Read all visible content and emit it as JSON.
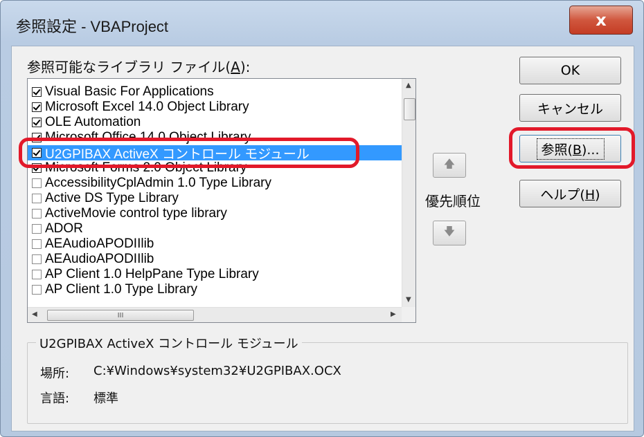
{
  "window": {
    "title": "参照設定 - VBAProject",
    "close_label": "x"
  },
  "library_label": {
    "text": "参照可能なライブラリ ファイル(",
    "mnemonic": "A",
    "suffix": "):"
  },
  "libraries": [
    {
      "name": "Visual Basic For Applications",
      "checked": true
    },
    {
      "name": "Microsoft Excel 14.0 Object Library",
      "checked": true
    },
    {
      "name": "OLE Automation",
      "checked": true
    },
    {
      "name": "Microsoft Office 14.0 Object Library",
      "checked": true
    },
    {
      "name": "U2GPIBAX ActiveX コントロール モジュール",
      "checked": true,
      "selected": true
    },
    {
      "name": "Microsoft Forms 2.0 Object Library",
      "checked": true
    },
    {
      "name": "AccessibilityCplAdmin 1.0 Type Library",
      "checked": false
    },
    {
      "name": "Active DS Type Library",
      "checked": false
    },
    {
      "name": "ActiveMovie control type library",
      "checked": false
    },
    {
      "name": "ADOR",
      "checked": false
    },
    {
      "name": "AEAudioAPODIIlib",
      "checked": false
    },
    {
      "name": "AEAudioAPODIIlib",
      "checked": false
    },
    {
      "name": "AP Client 1.0 HelpPane Type Library",
      "checked": false
    },
    {
      "name": "AP Client 1.0 Type Library",
      "checked": false
    }
  ],
  "hscroll_thumb": "III",
  "buttons": {
    "ok": "OK",
    "cancel": "キャンセル",
    "browse": {
      "text": "参照(",
      "mnemonic": "B",
      "suffix": ")..."
    },
    "help": {
      "text": "ヘルプ(",
      "mnemonic": "H",
      "suffix": ")"
    }
  },
  "priority": {
    "label": "優先順位",
    "up_icon": "arrow-up-icon",
    "down_icon": "arrow-down-icon"
  },
  "details": {
    "title": "U2GPIBAX ActiveX コントロール モジュール",
    "location_label": "場所:",
    "location_value": "C:¥Windows¥system32¥U2GPIBAX.OCX",
    "language_label": "言語:",
    "language_value": "標準"
  },
  "colors": {
    "selection": "#3399ff",
    "highlight_annotation": "#e2192a"
  }
}
